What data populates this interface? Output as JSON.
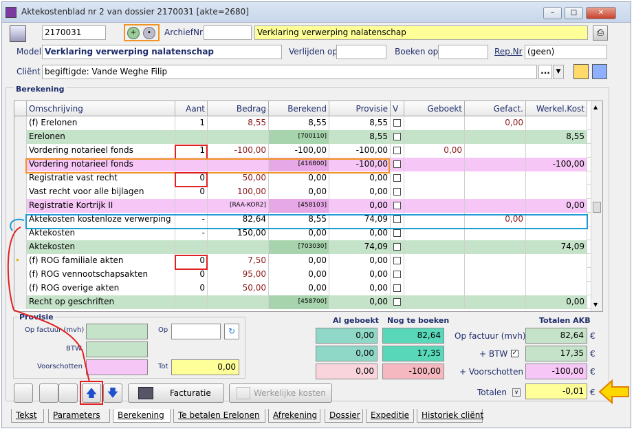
{
  "window": {
    "title": "Aktekostenblad nr 2 van dossier 2170031 [akte=2680]"
  },
  "header": {
    "dossier": "2170031",
    "archief_label": "ArchiefNr",
    "archief_value": "",
    "description": "Verklaring verwerping nalatenschap",
    "model_label": "Model",
    "model_value": "Verklaring verwerping nalatenschap",
    "verlijden_label": "Verlijden op",
    "boeken_label": "Boeken op",
    "rep_label": "Rep.Nr",
    "rep_value": "(geen)",
    "client_label": "Cliënt",
    "client_value": "begiftigde: Vande Weghe Filip",
    "client_dots": "..."
  },
  "section_label": "Berekening",
  "columns": [
    "Omschrijving",
    "Aant",
    "Bedrag",
    "Berekend",
    "Provisie",
    "V",
    "Geboekt",
    "Gefact.",
    "Werkel.Kost"
  ],
  "rows": [
    {
      "omschrijving": "(f) Erelonen",
      "aant": "1",
      "bedrag": "8,55",
      "berekend": "8,55",
      "provisie": "8,55",
      "geboekt": "",
      "gefact": "0,00",
      "werkel": "",
      "type": "normal",
      "bedrag_red": true,
      "gefact_red": true
    },
    {
      "omschrijving": "Erelonen",
      "aant": "",
      "bedrag": "",
      "berekend": "[700110]",
      "provisie": "8,55",
      "geboekt": "",
      "gefact": "",
      "werkel": "8,55",
      "type": "green"
    },
    {
      "omschrijving": "Vordering notarieel fonds",
      "aant": "1",
      "bedrag": "-100,00",
      "berekend": "-100,00",
      "provisie": "-100,00",
      "geboekt": "0,00",
      "gefact": "",
      "werkel": "",
      "type": "normal",
      "bedrag_red": true,
      "geboekt_red": true
    },
    {
      "omschrijving": "Vordering notarieel fonds",
      "aant": "",
      "bedrag": "",
      "berekend": "[416800]",
      "provisie": "-100,00",
      "geboekt": "",
      "gefact": "",
      "werkel": "-100,00",
      "type": "pink"
    },
    {
      "omschrijving": "Registratie vast recht",
      "aant": "0",
      "bedrag": "50,00",
      "berekend": "0,00",
      "provisie": "0,00",
      "geboekt": "",
      "gefact": "",
      "werkel": "",
      "type": "normal",
      "bedrag_red": true
    },
    {
      "omschrijving": "Vast recht voor alle bijlagen",
      "aant": "0",
      "bedrag": "100,00",
      "berekend": "0,00",
      "provisie": "0,00",
      "geboekt": "",
      "gefact": "",
      "werkel": "",
      "type": "normal",
      "bedrag_red": true
    },
    {
      "omschrijving": "Registratie Kortrijk II",
      "aant": "",
      "bedrag": "[RAA-KOR2]",
      "berekend": "[458103]",
      "provisie": "0,00",
      "geboekt": "",
      "gefact": "",
      "werkel": "0,00",
      "type": "pink"
    },
    {
      "omschrijving": "Aktekosten kostenloze verwerping",
      "aant": "-",
      "bedrag": "82,64",
      "berekend": "8,55",
      "provisie": "74,09",
      "geboekt": "",
      "gefact": "0,00",
      "werkel": "",
      "type": "normal",
      "gefact_red": true
    },
    {
      "omschrijving": "Aktekosten",
      "aant": "-",
      "bedrag": "150,00",
      "berekend": "0,00",
      "provisie": "0,00",
      "geboekt": "",
      "gefact": "",
      "werkel": "",
      "type": "normal"
    },
    {
      "omschrijving": "Aktekosten",
      "aant": "",
      "bedrag": "",
      "berekend": "[703030]",
      "provisie": "74,09",
      "geboekt": "",
      "gefact": "",
      "werkel": "74,09",
      "type": "green"
    },
    {
      "omschrijving": "(f) ROG familiale akten",
      "aant": "0",
      "bedrag": "7,50",
      "berekend": "0,00",
      "provisie": "0,00",
      "geboekt": "",
      "gefact": "",
      "werkel": "",
      "type": "normal",
      "bedrag_red": true
    },
    {
      "omschrijving": "(f) ROG vennootschapsakten",
      "aant": "0",
      "bedrag": "95,00",
      "berekend": "0,00",
      "provisie": "0,00",
      "geboekt": "",
      "gefact": "",
      "werkel": "",
      "type": "normal",
      "bedrag_red": true
    },
    {
      "omschrijving": "(f) ROG overige akten",
      "aant": "0",
      "bedrag": "50,00",
      "berekend": "0,00",
      "provisie": "0,00",
      "geboekt": "",
      "gefact": "",
      "werkel": "",
      "type": "normal",
      "bedrag_red": true
    },
    {
      "omschrijving": "Recht op geschriften",
      "aant": "",
      "bedrag": "",
      "berekend": "[458700]",
      "provisie": "0,00",
      "geboekt": "",
      "gefact": "",
      "werkel": "0,00",
      "type": "green"
    }
  ],
  "provisie": {
    "title": "Provisie",
    "op_factuur_label": "Op factuur (mvh)",
    "btw_label": "BTW",
    "voorschotten_label": "Voorschotten",
    "op_label": "Op",
    "tot_label": "Tot",
    "tot_value": "0,00"
  },
  "totals": {
    "al_geboekt_label": "Al geboekt",
    "nog_label": "Nog te boeken",
    "totalen_akb_label": "Totalen AKB",
    "op_factuur_label": "Op factuur (mvh)",
    "btw_label": "+ BTW",
    "voorschotten_label": "+ Voorschotten",
    "totalen_label": "Totalen",
    "al": [
      "0,00",
      "0,00",
      "0,00"
    ],
    "nog": [
      "82,64",
      "17,35",
      "-100,00"
    ],
    "akb": [
      "82,64",
      "17,35",
      "-100,00"
    ],
    "totaal": "-0,01",
    "euro": "€"
  },
  "buttons": {
    "facturatie": "Facturatie",
    "werkelijke": "Werkelijke kosten"
  },
  "tabs": [
    "Tekst",
    "Parameters",
    "Berekening",
    "Te betalen Erelonen",
    "Afrekening",
    "Dossier",
    "Expeditie",
    "Historiek cliënt"
  ],
  "colors": {
    "green": "#c5e3c9",
    "pink": "#f6c6f6",
    "yellow": "#ffff99",
    "teal": "#8fd8c8",
    "lightpink": "#f9d4dc",
    "annotation_red": "#e02020",
    "annotation_orange": "#f29423",
    "annotation_blue": "#1e9ad6"
  }
}
